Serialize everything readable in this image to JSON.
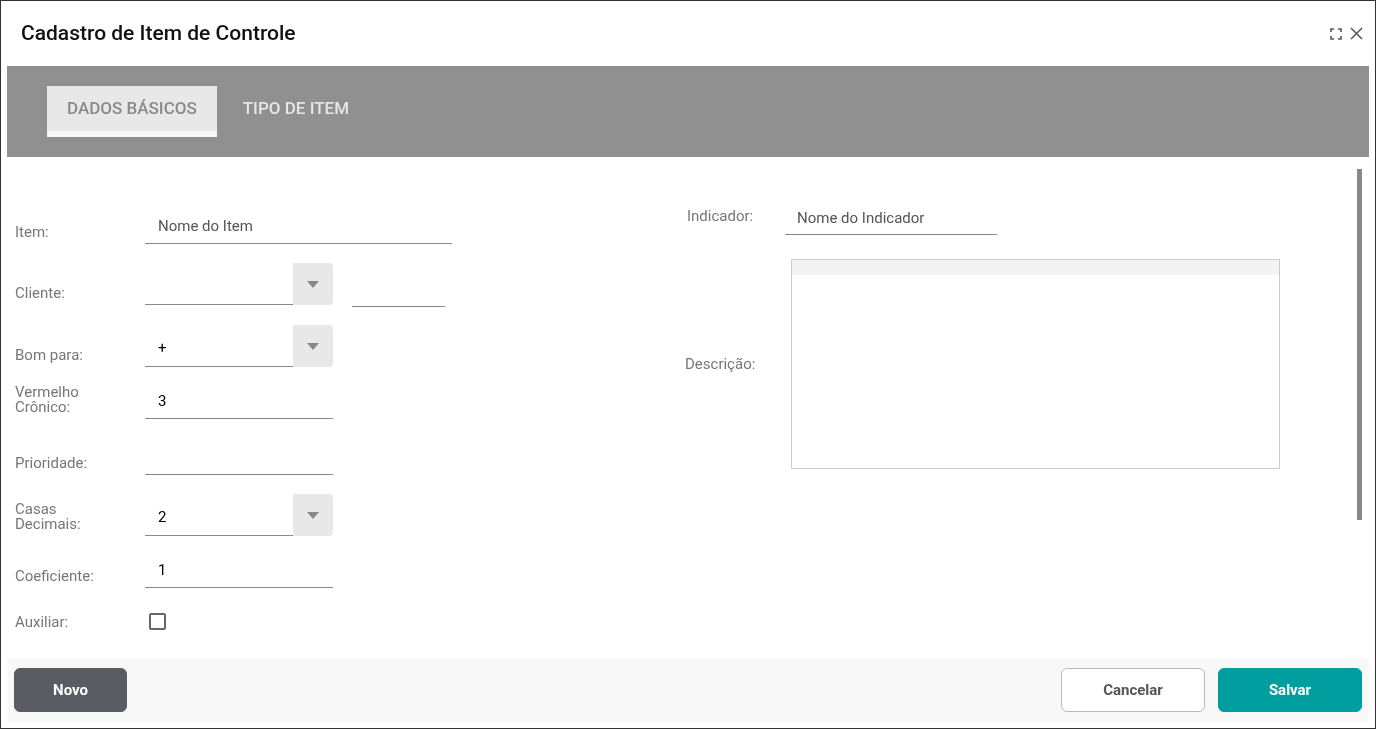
{
  "window": {
    "title": "Cadastro de Item de Controle"
  },
  "tabs": [
    {
      "label": "DADOS BÁSICOS",
      "selected": true
    },
    {
      "label": "TIPO DE ITEM",
      "selected": false
    }
  ],
  "left_fields": [
    {
      "label": "Item:",
      "kind": "wide_text",
      "placeholder": "Nome do Item"
    },
    {
      "label": "Cliente:",
      "kind": "select_extra"
    },
    {
      "label": "Bom para:",
      "kind": "select",
      "value": "+"
    },
    {
      "label": "Vermelho Crônico:",
      "kind": "text",
      "value": "3"
    },
    {
      "label": "Prioridade:",
      "kind": "text"
    },
    {
      "label": "Casas Decimais:",
      "kind": "select",
      "value": "2"
    },
    {
      "label": "Coeficiente:",
      "kind": "text",
      "value": "1"
    },
    {
      "label": "Auxiliar:",
      "kind": "checkbox",
      "checked": false
    }
  ],
  "indicator": {
    "label": "Indicador:",
    "placeholder": "Nome do Indicador"
  },
  "description": {
    "label": "Descrição:"
  },
  "buttons": [
    {
      "label": "Novo",
      "kind": "dark"
    },
    {
      "label": "Cancelar",
      "kind": "outline"
    },
    {
      "label": "Salvar",
      "kind": "primary"
    }
  ]
}
